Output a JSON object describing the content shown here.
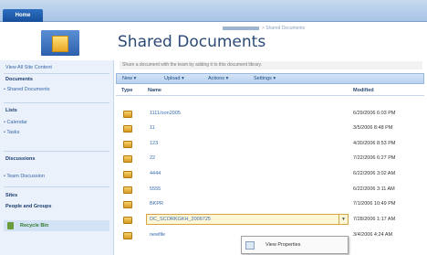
{
  "topbar": {
    "home_tab": "Home"
  },
  "header": {
    "breadcrumb": "> Shared Documents",
    "title": "Shared Documents"
  },
  "sidebar": {
    "view_all": "View All Site Content",
    "documents_head": "Documents",
    "shared_docs": "• Shared Documents",
    "lists_head": "Lists",
    "calendar": "• Calendar",
    "tasks": "• Tasks",
    "discussions_head": "Discussions",
    "team_discussion": "• Team Discussion",
    "sites_head": "Sites",
    "people_head": "People and Groups",
    "recycle_bin": "Recycle Bin"
  },
  "library": {
    "description": "Share a document with the team by adding it to this document library.",
    "toolbar": {
      "new": "New ▾",
      "upload": "Upload ▾",
      "actions": "Actions ▾",
      "settings": "Settings ▾"
    },
    "columns": {
      "type": "Type",
      "name": "Name",
      "modified": "Modified"
    },
    "rows": [
      {
        "name": "1111/oon2005",
        "modified": "6/29/2006 6:03 PM"
      },
      {
        "name": "11",
        "modified": "3/5/2006 8:48 PM"
      },
      {
        "name": "123",
        "modified": "4/30/2006 8:53 PM"
      },
      {
        "name": "22",
        "modified": "7/22/2006 6:27 PM"
      },
      {
        "name": "4444",
        "modified": "6/22/2006 3:02 AM"
      },
      {
        "name": "5555",
        "modified": "6/22/2006 3:11 AM"
      },
      {
        "name": "BKPR",
        "modified": "7/1/2006 10:49 PM"
      },
      {
        "name": "DC_SCORKGKH_2006725",
        "modified": "7/28/2006 1:17 AM"
      },
      {
        "name": "newfile",
        "modified": "3/4/2006 4:24 AM"
      }
    ],
    "context_menu": {
      "view_properties": "View Properties"
    }
  }
}
